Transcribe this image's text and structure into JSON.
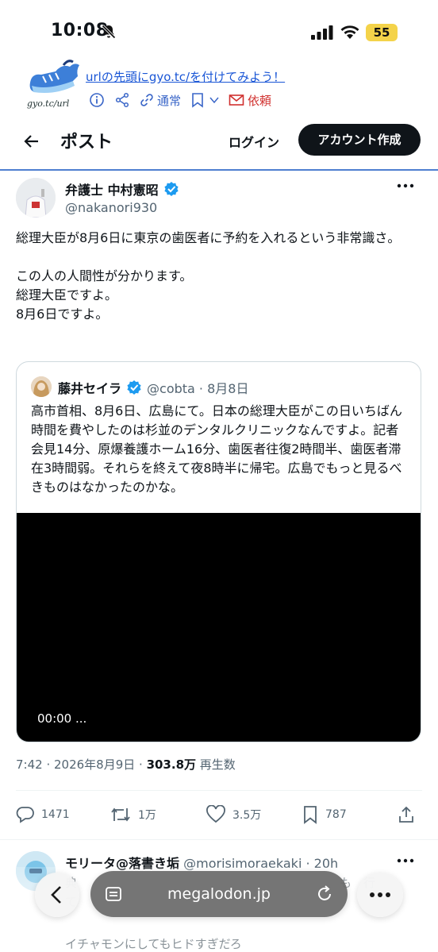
{
  "status_bar": {
    "time": "10:08",
    "battery": "55"
  },
  "banner": {
    "logo_text": "gyo.tc/url",
    "link_text": "urlの先頭にgyo.tc/を付けてみよう！",
    "tools": {
      "share_label": "通常",
      "request_label": "依頼"
    }
  },
  "header": {
    "title": "ポスト",
    "login": "ログイン",
    "create_account": "アカウント作成"
  },
  "post": {
    "author_name": "弁護士 中村憲昭",
    "author_handle": "@nakanori930",
    "text": "総理大臣が8月6日に東京の歯医者に予約を入れるという非常識さ。\n\nこの人の人間性が分かります。\n総理大臣ですよ。\n8月6日ですよ。",
    "meta_time": "7:42 · 2026年8月9日 · ",
    "meta_views": "303.8万",
    "meta_views_label": " 再生数"
  },
  "quote": {
    "author_name": "藤井セイラ",
    "author_handle": "@cobta · 8月8日",
    "text": "高市首相、8月6日、広島にて。日本の総理大臣がこの日いちばん時間を費やしたのは杉並のデンタルクリニックなんですよ。記者会見14分、原爆養護ホーム16分、歯医者往復2時間半、歯医者滞在3時間弱。それらを終えて夜8時半に帰宅。広島でもっと見るべきものはなかったのかな。",
    "video_time": "00:00 ..."
  },
  "actions": {
    "replies": "1471",
    "reposts": "1万",
    "likes": "3.5万",
    "bookmarks": "787"
  },
  "reply": {
    "author_name": "モリータ@落書き垢",
    "author_handle": "@morisimoraekaki · 20h",
    "text_visible": "典",
    "text_right": "も　行",
    "text_line2": "て",
    "text_line3": "イチャモンにしてもヒドすぎだろ"
  },
  "browser": {
    "url": "megalodon.jp"
  },
  "colors": {
    "accent": "#1d9bf0",
    "link": "#1a56d6",
    "text": "#0f1419",
    "muted": "#536471"
  }
}
